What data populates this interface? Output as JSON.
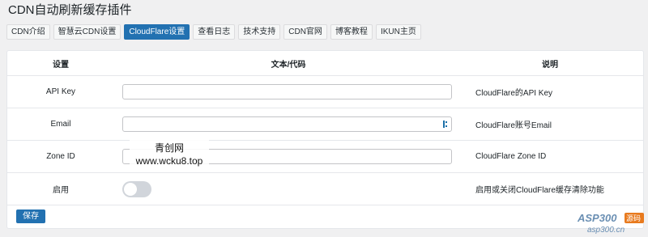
{
  "page": {
    "title": "CDN自动刷新缓存插件"
  },
  "tabs": [
    {
      "label": "CDN介绍"
    },
    {
      "label": "智慧云CDN设置"
    },
    {
      "label": "CloudFlare设置"
    },
    {
      "label": "查看日志"
    },
    {
      "label": "技术支持"
    },
    {
      "label": "CDN官网"
    },
    {
      "label": "博客教程"
    },
    {
      "label": "IKUN主页"
    }
  ],
  "active_tab": "CloudFlare设置",
  "table": {
    "headers": [
      "设置",
      "文本/代码",
      "说明"
    ],
    "rows": [
      {
        "label": "API Key",
        "value": "",
        "desc": "CloudFlare的API Key"
      },
      {
        "label": "Email",
        "value": "",
        "desc": "CloudFlare账号Email"
      },
      {
        "label": "Zone ID",
        "value": "",
        "desc": "CloudFlare Zone ID"
      },
      {
        "label": "启用",
        "toggle": "off",
        "desc": "启用或关闭CloudFlare缓存清除功能"
      }
    ]
  },
  "save_label": "保存",
  "watermark": {
    "line1": "青创网",
    "line2": "www.wcku8.top"
  },
  "logo": {
    "brand": "ASP300",
    "badge": "源码",
    "url": "asp300.cn"
  },
  "colors": {
    "accent": "#2271b1",
    "toggle_off": "#d1d5db"
  }
}
